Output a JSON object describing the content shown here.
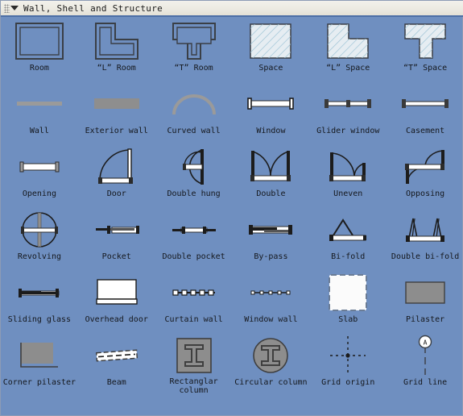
{
  "titlebar": {
    "title": "Wall, Shell and Structure",
    "grip_icon": "drag-grip-icon",
    "caret_icon": "chevron-down-icon"
  },
  "colors": {
    "background": "#6f8fc0",
    "titlebar_bg": "#eceae2",
    "titlebar_rule": "#4d6fa6",
    "wall_gray": "#9a9a9a",
    "shape_outline": "#3a3f46",
    "space_fill": "#e6edf2",
    "space_hatch": "#9fc4d6",
    "white_fill": "#ffffff",
    "label_text": "#15181d",
    "pilaster_fill": "#8d8d8d"
  },
  "shapes": [
    {
      "label": "Room",
      "icon": "room-shape-icon"
    },
    {
      "label": "“L” Room",
      "icon": "l-room-shape-icon"
    },
    {
      "label": "“T” Room",
      "icon": "t-room-shape-icon"
    },
    {
      "label": "Space",
      "icon": "space-shape-icon"
    },
    {
      "label": "“L” Space",
      "icon": "l-space-shape-icon"
    },
    {
      "label": "“T” Space",
      "icon": "t-space-shape-icon"
    },
    {
      "label": "Wall",
      "icon": "wall-shape-icon"
    },
    {
      "label": "Exterior wall",
      "icon": "exterior-wall-shape-icon"
    },
    {
      "label": "Curved wall",
      "icon": "curved-wall-shape-icon"
    },
    {
      "label": "Window",
      "icon": "window-shape-icon"
    },
    {
      "label": "Glider window",
      "icon": "glider-window-shape-icon"
    },
    {
      "label": "Casement",
      "icon": "casement-shape-icon"
    },
    {
      "label": "Opening",
      "icon": "opening-shape-icon"
    },
    {
      "label": "Door",
      "icon": "door-shape-icon"
    },
    {
      "label": "Double hung",
      "icon": "double-hung-shape-icon"
    },
    {
      "label": "Double",
      "icon": "double-door-shape-icon"
    },
    {
      "label": "Uneven",
      "icon": "uneven-door-shape-icon"
    },
    {
      "label": "Opposing",
      "icon": "opposing-door-shape-icon"
    },
    {
      "label": "Revolving",
      "icon": "revolving-door-shape-icon"
    },
    {
      "label": "Pocket",
      "icon": "pocket-door-shape-icon"
    },
    {
      "label": "Double pocket",
      "icon": "double-pocket-shape-icon"
    },
    {
      "label": "By-pass",
      "icon": "by-pass-shape-icon"
    },
    {
      "label": "Bi-fold",
      "icon": "bi-fold-shape-icon"
    },
    {
      "label": "Double bi-fold",
      "icon": "double-bi-fold-shape-icon"
    },
    {
      "label": "Sliding glass",
      "icon": "sliding-glass-shape-icon"
    },
    {
      "label": "Overhead door",
      "icon": "overhead-door-shape-icon"
    },
    {
      "label": "Curtain wall",
      "icon": "curtain-wall-shape-icon"
    },
    {
      "label": "Window wall",
      "icon": "window-wall-shape-icon"
    },
    {
      "label": "Slab",
      "icon": "slab-shape-icon"
    },
    {
      "label": "Pilaster",
      "icon": "pilaster-shape-icon"
    },
    {
      "label": "Corner pilaster",
      "icon": "corner-pilaster-shape-icon"
    },
    {
      "label": "Beam",
      "icon": "beam-shape-icon"
    },
    {
      "label": "Rectanglar column",
      "icon": "rectangular-column-shape-icon"
    },
    {
      "label": "Circular column",
      "icon": "circular-column-shape-icon"
    },
    {
      "label": "Grid origin",
      "icon": "grid-origin-shape-icon"
    },
    {
      "label": "Grid line",
      "icon": "grid-line-shape-icon"
    }
  ],
  "grid_line_marker_label": "A"
}
